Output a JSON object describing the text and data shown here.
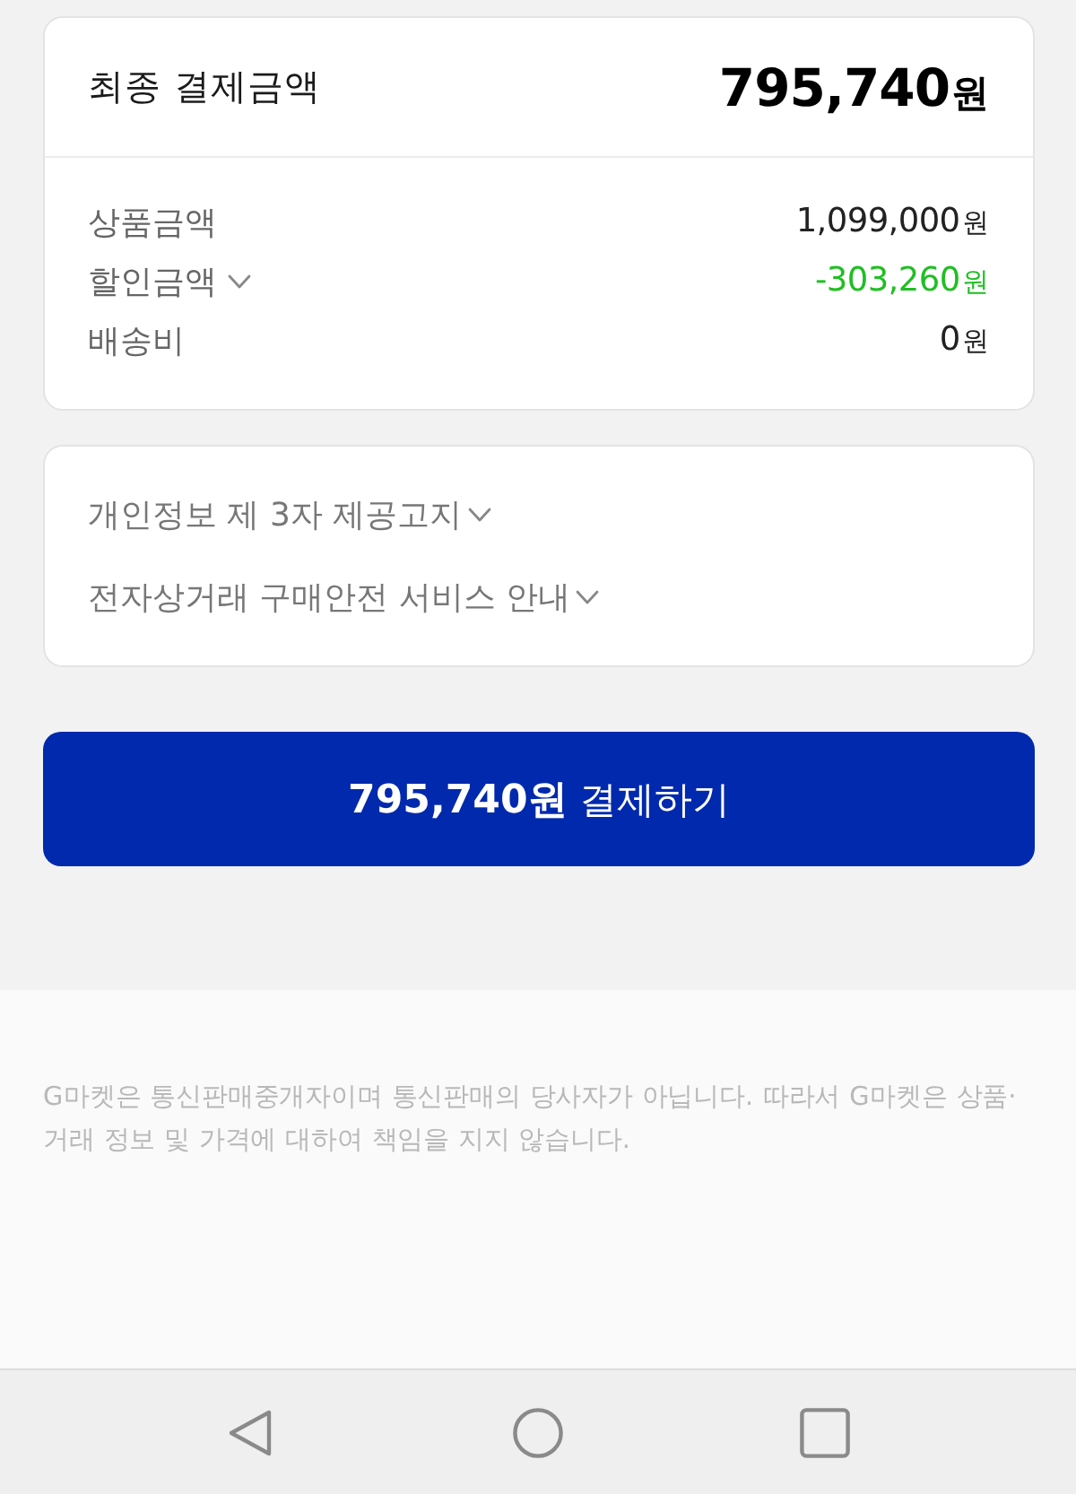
{
  "summary": {
    "title": "최종 결제금액",
    "total_amount": "795,740",
    "total_unit": "원",
    "rows": [
      {
        "kind": "plain",
        "label": "상품금액",
        "value": "1,099,000",
        "unit": "원"
      },
      {
        "kind": "discount",
        "label": "할인금액",
        "value": "-303,260",
        "unit": "원",
        "expanded": false
      },
      {
        "kind": "plain",
        "label": "배송비",
        "value": "0",
        "unit": "원"
      }
    ]
  },
  "notices": [
    {
      "label": "개인정보 제 3자 제공고지",
      "expanded": false
    },
    {
      "label": "전자상거래 구매안전 서비스 안내",
      "expanded": false
    }
  ],
  "pay_button": {
    "label": "**795,740원** 결제하기"
  },
  "disclaimer": "G마켓은 통신판매중개자이며 통신판매의 당사자가 아닙니다. 따라서 G마켓은 상품·거래 정보 및 가격에 대하여 책임을 지지 않습니다."
}
